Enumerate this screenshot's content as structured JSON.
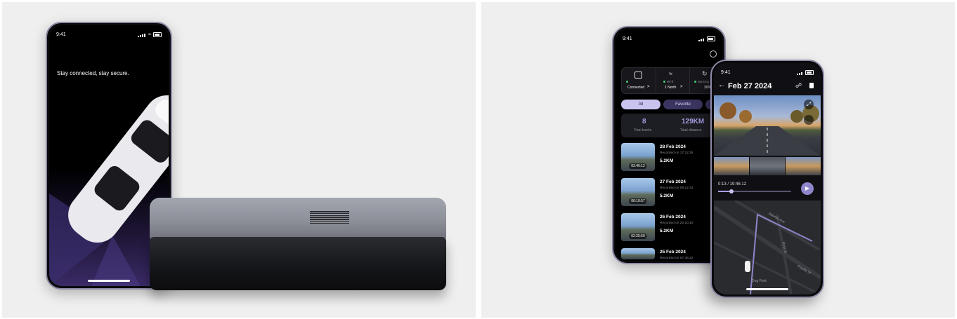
{
  "left_phone": {
    "time": "9:41",
    "tagline": "Stay connected, stay secure."
  },
  "back_phone": {
    "time": "9:41",
    "status_cards": [
      {
        "label": "Connected",
        "arrow": ">"
      },
      {
        "label": "Wi-fi",
        "sub": "1 North",
        "arrow": ">"
      },
      {
        "label": "Syncing",
        "sub": "30%",
        "arrow": ">"
      }
    ],
    "filters": [
      "All",
      "Favorite"
    ],
    "stats": [
      {
        "value": "8",
        "label": "Total tracks"
      },
      {
        "value": "129KM",
        "label": "Total distance"
      }
    ],
    "tracks": [
      {
        "date": "28 Feb 2024",
        "recorded": "Recorded on 17:12:25",
        "distance": "5.2KM",
        "duration": "03:46:12"
      },
      {
        "date": "27 Feb 2024",
        "recorded": "Recorded on 08:12:24",
        "distance": "5.2KM",
        "duration": "00:10:57"
      },
      {
        "date": "26 Feb 2024",
        "recorded": "Recorded on 20:10:10",
        "distance": "5.2KM",
        "duration": "02:25:50"
      },
      {
        "date": "25 Feb 2024",
        "recorded": "Recorded on 07:36:22",
        "distance": "",
        "duration": ""
      }
    ]
  },
  "front_phone": {
    "time": "9:41",
    "title": "Feb 27 2024",
    "playback": "0:13 / 19:46:12",
    "progress": 0.18,
    "map_labels": [
      "Atlantic Ave",
      "Hoyt St",
      "Pacific St",
      "Dog Park"
    ]
  },
  "colors": {
    "accent": "#8e86c9",
    "accent_light": "#c9c4ef",
    "panel_bg": "#efefef",
    "phone_dark": "#0a0a0c"
  }
}
